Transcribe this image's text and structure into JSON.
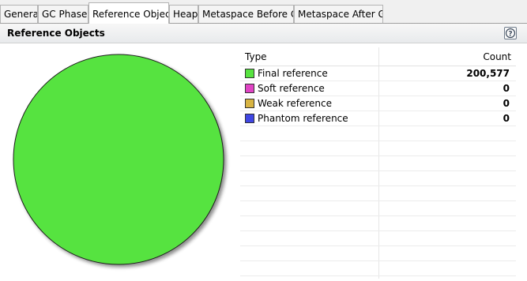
{
  "tabs": [
    {
      "label": "General"
    },
    {
      "label": "GC Phases"
    },
    {
      "label": "Reference Objects",
      "active": true
    },
    {
      "label": "Heap"
    },
    {
      "label": "Metaspace Before GC"
    },
    {
      "label": "Metaspace After GC"
    }
  ],
  "section": {
    "title": "Reference Objects",
    "help_icon": "help-icon"
  },
  "table": {
    "columns": {
      "type": "Type",
      "count": "Count"
    },
    "rows": [
      {
        "label": "Final reference",
        "value": "200,577",
        "color": "#57e340"
      },
      {
        "label": "Soft reference",
        "value": "0",
        "color": "#e043c4"
      },
      {
        "label": "Weak reference",
        "value": "0",
        "color": "#d8b443"
      },
      {
        "label": "Phantom reference",
        "value": "0",
        "color": "#3f46e3"
      }
    ]
  },
  "chart_data": {
    "type": "pie",
    "categories": [
      "Final reference",
      "Soft reference",
      "Weak reference",
      "Phantom reference"
    ],
    "values": [
      200577,
      0,
      0,
      0
    ],
    "colors": [
      "#57e340",
      "#e043c4",
      "#d8b443",
      "#3f46e3"
    ]
  }
}
